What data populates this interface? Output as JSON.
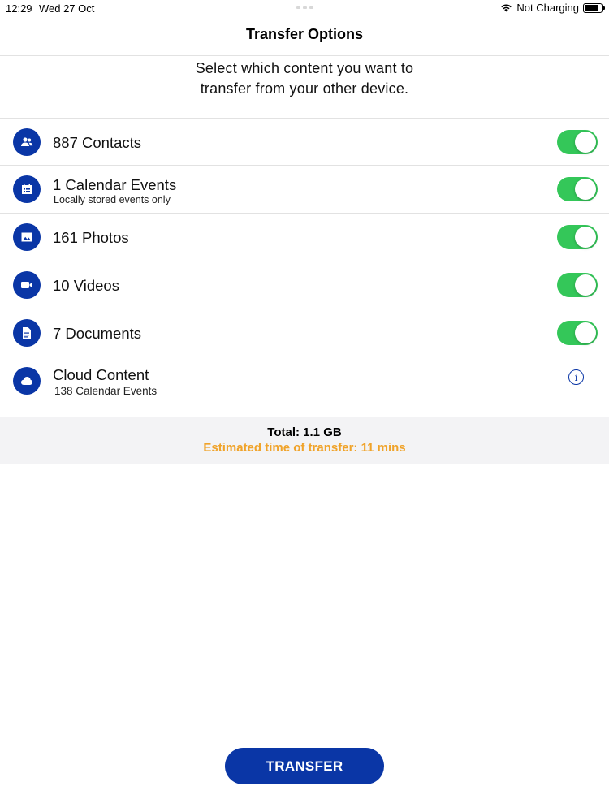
{
  "status_bar": {
    "time": "12:29",
    "date": "Wed 27 Oct",
    "charging_status": "Not Charging",
    "battery_level": 0.85
  },
  "nav": {
    "title": "Transfer Options"
  },
  "intro_text": "Select which content you want to transfer from your other device.",
  "items": [
    {
      "icon": "contacts-icon",
      "title": "887 Contacts",
      "subtitle": "",
      "enabled": true
    },
    {
      "icon": "calendar-icon",
      "title": "1 Calendar Events",
      "subtitle": "Locally stored events only",
      "enabled": true
    },
    {
      "icon": "photo-icon",
      "title": "161 Photos",
      "subtitle": "",
      "enabled": true
    },
    {
      "icon": "video-icon",
      "title": "10 Videos",
      "subtitle": "",
      "enabled": true
    },
    {
      "icon": "document-icon",
      "title": "7 Documents",
      "subtitle": "",
      "enabled": true
    }
  ],
  "cloud": {
    "icon": "cloud-icon",
    "title": "Cloud Content",
    "subtitle": "138 Calendar Events",
    "info_glyph": "i"
  },
  "summary": {
    "total": "Total: 1.1 GB",
    "eta": "Estimated time of transfer: 11 mins"
  },
  "transfer_button_label": "TRANSFER",
  "colors": {
    "brand": "#0a36a6",
    "toggle_on": "#34c759",
    "eta": "#f0a32a"
  }
}
